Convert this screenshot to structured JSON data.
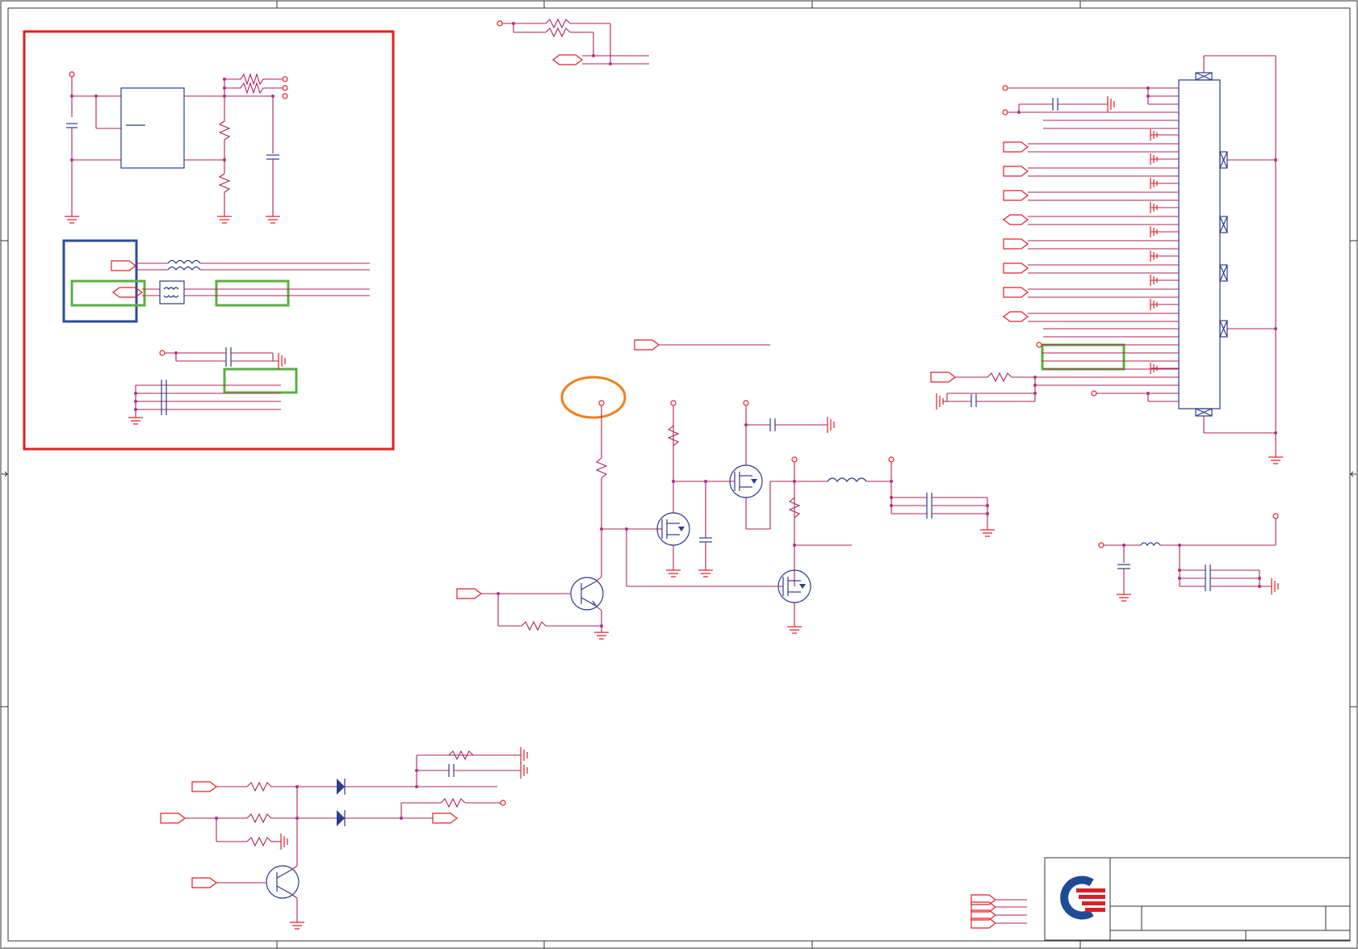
{
  "sheet": {
    "colors": {
      "wire": "#b0205a",
      "power": "#e0202a",
      "component": "#2a3c8c",
      "highlight_red": "#e02020",
      "highlight_blue": "#2a4ca0",
      "highlight_green": "#5ab040",
      "highlight_orange": "#f08020",
      "logo_blue": "#1f4a94",
      "logo_red": "#d8202a"
    },
    "highlights": [
      {
        "kind": "box",
        "color": "red",
        "label": "power-and-lvds-block"
      },
      {
        "kind": "box",
        "color": "blue",
        "label": "differential-pair-block"
      },
      {
        "kind": "box",
        "color": "green",
        "label": "choke-pair-left"
      },
      {
        "kind": "box",
        "color": "green",
        "label": "trace-pair-right"
      },
      {
        "kind": "box",
        "color": "green",
        "label": "cap-group"
      },
      {
        "kind": "box",
        "color": "green",
        "label": "connector-signal-pair"
      },
      {
        "kind": "ellipse",
        "color": "orange",
        "label": "power-rail-node"
      }
    ],
    "title_block": {
      "logo": "company-logo-icon",
      "title": "",
      "sheet_number": ""
    }
  }
}
